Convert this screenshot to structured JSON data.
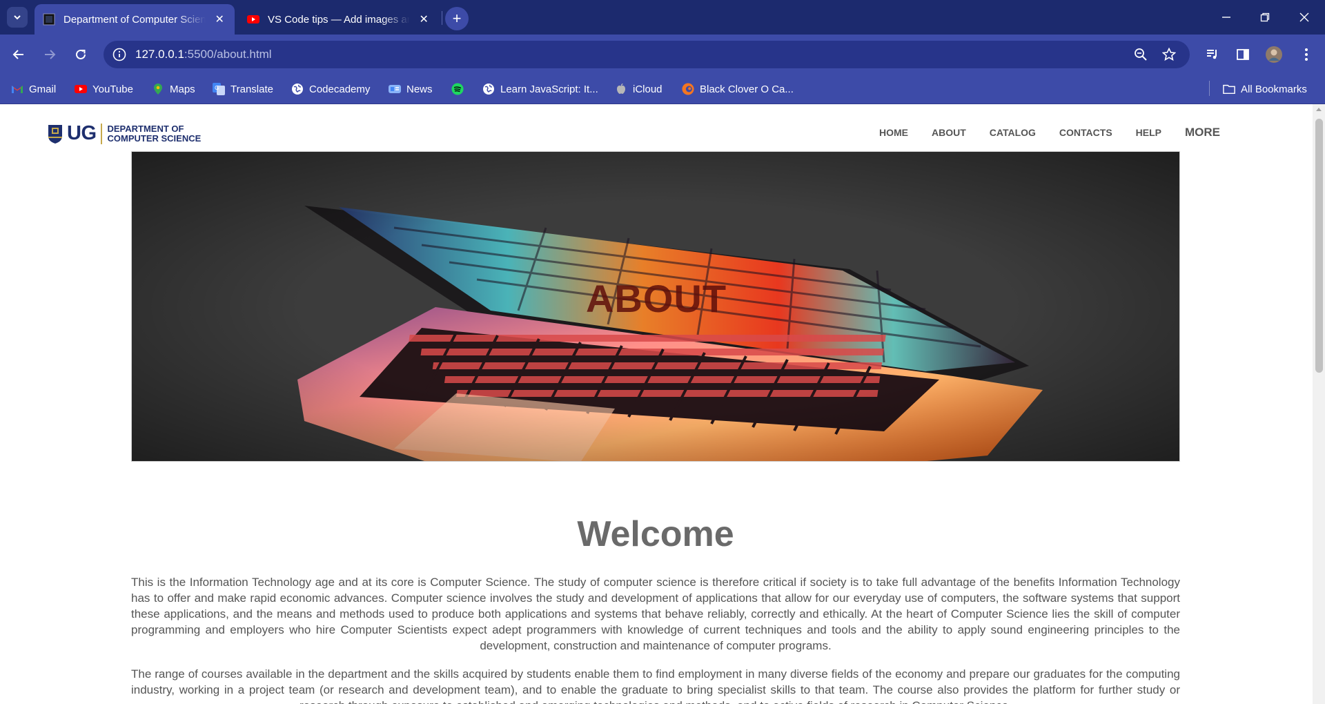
{
  "browser": {
    "tabs": [
      {
        "title": "Department of Computer Science",
        "active": true
      },
      {
        "title": "VS Code tips — Add images and videos",
        "active": false
      }
    ],
    "url_host": "127.0.0.1",
    "url_path": ":5500/about.html",
    "bookmarks": [
      {
        "label": "Gmail",
        "icon": "gmail-icon"
      },
      {
        "label": "YouTube",
        "icon": "youtube-icon"
      },
      {
        "label": "Maps",
        "icon": "maps-icon"
      },
      {
        "label": "Translate",
        "icon": "translate-icon"
      },
      {
        "label": "Codecademy",
        "icon": "globe-icon"
      },
      {
        "label": "News",
        "icon": "news-icon"
      },
      {
        "label": "",
        "icon": "spotify-icon"
      },
      {
        "label": "Learn JavaScript: It...",
        "icon": "globe-icon"
      },
      {
        "label": "iCloud",
        "icon": "apple-icon"
      },
      {
        "label": "Black Clover O Ca...",
        "icon": "crunchyroll-icon"
      }
    ],
    "all_bookmarks": "All Bookmarks",
    "colors": {
      "tabstrip": "#1c2a6e",
      "toolbar": "#3d4ba8"
    }
  },
  "site": {
    "logo": {
      "ug": "UG",
      "dept_line1": "DEPARTMENT OF",
      "dept_line2": "COMPUTER SCIENCE"
    },
    "nav": [
      "HOME",
      "ABOUT",
      "CATALOG",
      "CONTACTS",
      "HELP",
      "MORE"
    ],
    "hero_title": "ABOUT",
    "welcome": "Welcome",
    "paragraphs": [
      "This is the Information Technology age and at its core is Computer Science. The study of computer science is therefore critical if society is to take full advantage of the benefits Information Technology has to offer and make rapid economic advances. Computer science involves the study and development of applications that allow for our everyday use of computers, the software systems that support these applications, and the means and methods used to produce both applications and systems that behave reliably, correctly and ethically. At the heart of Computer Science lies the skill of computer programming and employers who hire Computer Scientists expect adept programmers with knowledge of current techniques and tools and the ability to apply sound engineering principles to the development, construction and maintenance of computer programs.",
      "The range of courses available in the department and the skills acquired by students enable them to find employment in many diverse fields of the economy and prepare our graduates for the computing industry, working in a project team (or research and development team), and to enable the graduate to bring specialist skills to that team. The course also provides the platform for further study or research through exposure to established and emerging technologies and methods, and to active fields of research in Computer Science."
    ]
  }
}
